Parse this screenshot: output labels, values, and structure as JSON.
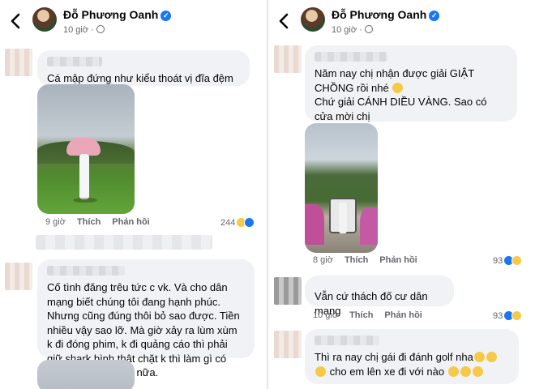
{
  "left": {
    "header": {
      "name": "Đỗ Phương Oanh",
      "time": "10 giờ"
    },
    "comments": [
      {
        "text": "Cá mập đứng như kiểu thoát vị đĩa đệm ý nhỉ",
        "meta_time": "9 giờ",
        "like": "Thích",
        "reply": "Phản hồi",
        "reaction_count": "244"
      },
      {
        "text": "Cố tình đăng trêu tức c vk. Và cho dân mạng biết chúng tôi đang hạnh phúc. Nhưng cũng đúng thôi bỏ sao được. Tiền nhiều vậy sao lỡ. Mà giờ xảy ra lùm xùm k đi đóng phim, k đi quảng cáo thì phải giữ  shark  bình thật chặt k thì làm gì có tiền mà hưởng thụ nữa."
      }
    ]
  },
  "right": {
    "header": {
      "name": "Đỗ Phương Oanh",
      "time": "10 giờ"
    },
    "comments": [
      {
        "text_a": "Năm nay chị nhận được giải GIẬT CHỒNG rồi nhé",
        "text_b": "Chứ giải CÁNH DIỀU VÀNG. Sao có cửa mời chị",
        "meta_time": "8 giờ",
        "like": "Thích",
        "reply": "Phản hồi",
        "reaction_count": "93"
      },
      {
        "text": "Vẫn cứ thách đố cư dân mạng",
        "meta_time": "10 giờ",
        "like": "Thích",
        "reply": "Phản hồi",
        "reaction_count": "93"
      },
      {
        "text_a": "Thì ra nay chị gái đi đánh golf nha",
        "text_b": "cho em lên xe đi với nào"
      }
    ]
  },
  "icons": {
    "back": "chevron-left-icon",
    "verified": "verified-badge-icon",
    "privacy": "globe-icon",
    "reactions": [
      "haha-reaction-icon",
      "like-reaction-icon"
    ]
  },
  "colors": {
    "bubble": "#f0f2f5",
    "verified": "#1877f2",
    "meta": "#65676b"
  }
}
